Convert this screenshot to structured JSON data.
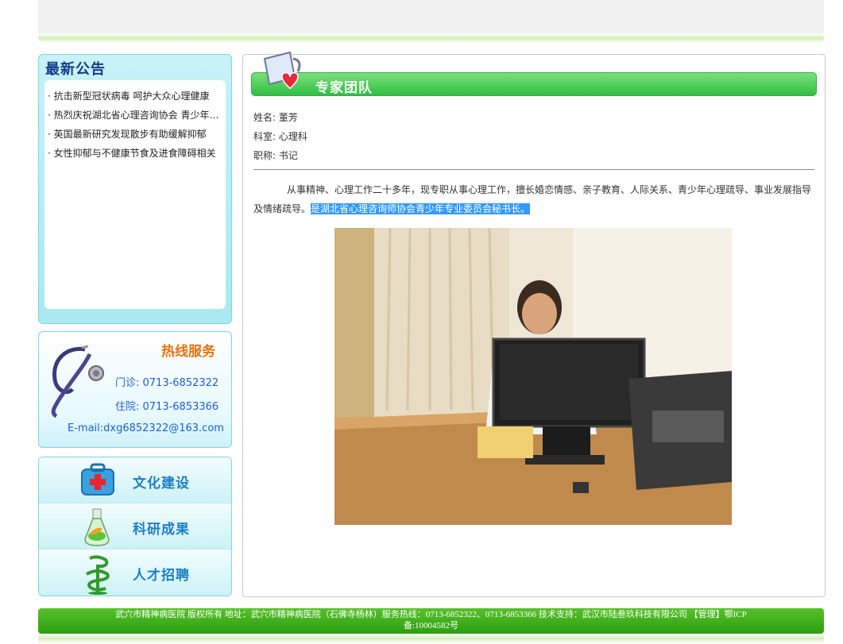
{
  "notices": {
    "title": "最新公告",
    "items": [
      "抗击新型冠状病毒  呵护大众心理健康",
      "热烈庆祝湖北省心理咨询协会 青少年…",
      "英国最新研究发现散步有助缓解抑郁",
      "女性抑郁与不健康节食及进食障碍相关"
    ]
  },
  "hotline": {
    "title": "热线服务",
    "outpatient": "门诊:   0713-6852322",
    "inpatient": "住院:   0713-6853366",
    "email": "E-mail:dxg6852322@163.com"
  },
  "menu": {
    "culture": "文化建设",
    "research": "科研成果",
    "recruit": "人才招聘"
  },
  "main": {
    "section_title": "专家团队",
    "name": "姓名: 董芳",
    "department": "科室: 心理科",
    "title": "职称: 书记",
    "description": "从事精神、心理工作二十多年，现专职从事心理工作，擅长婚恋情感、亲子教育、人际关系、青少年心理疏导、事业发展指导及情绪疏导。",
    "highlight": "是湖北省心理咨询师协会青少年专业委员会秘书长。"
  },
  "footer": {
    "line1": "武穴市精神病医院 版权所有   地址：武穴市精神病医院（石佛寺杨林）服务热线：0713-6852322、0713-6853366      技术支持：武汉市陆叁玖科技有限公司  【管理】鄂ICP",
    "line2": "备:10004582号"
  },
  "colors": {
    "accent_green": "#2fbf44",
    "panel_cyan": "#a9e9f1",
    "link_blue": "#1f5fd0",
    "hotline_orange": "#e8720e"
  },
  "icons": [
    "stethoscope-icon",
    "medical-kit-icon",
    "flask-icon",
    "caduceus-icon",
    "mug-heart-icon"
  ]
}
